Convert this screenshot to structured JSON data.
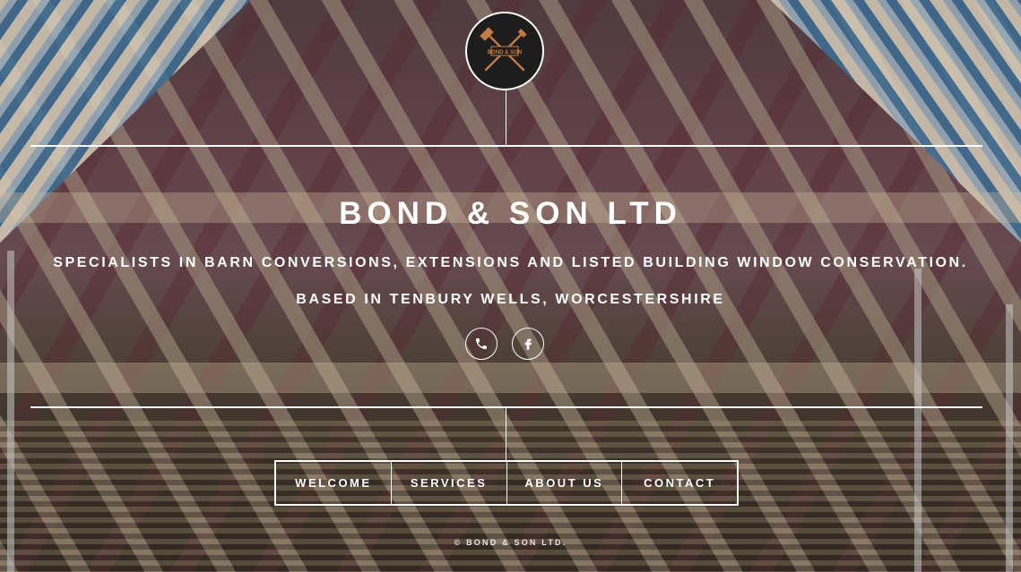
{
  "brand": {
    "title": "BOND & SON LTD",
    "logo_text": "BOND & SON"
  },
  "hero": {
    "tagline": "SPECIALISTS IN BARN CONVERSIONS, EXTENSIONS AND LISTED BUILDING WINDOW CONSERVATION.",
    "location": "BASED IN TENBURY WELLS, WORCESTERSHIRE"
  },
  "social": [
    {
      "icon": "phone-icon"
    },
    {
      "icon": "facebook-icon"
    }
  ],
  "nav": {
    "welcome": "WELCOME",
    "services": "SERVICES",
    "about": "ABOUT US",
    "contact": "CONTACT"
  },
  "footer": {
    "copyright": "© BOND & SON LTD."
  },
  "colors": {
    "logo_accent": "#c47a45",
    "text": "#ffffff"
  }
}
